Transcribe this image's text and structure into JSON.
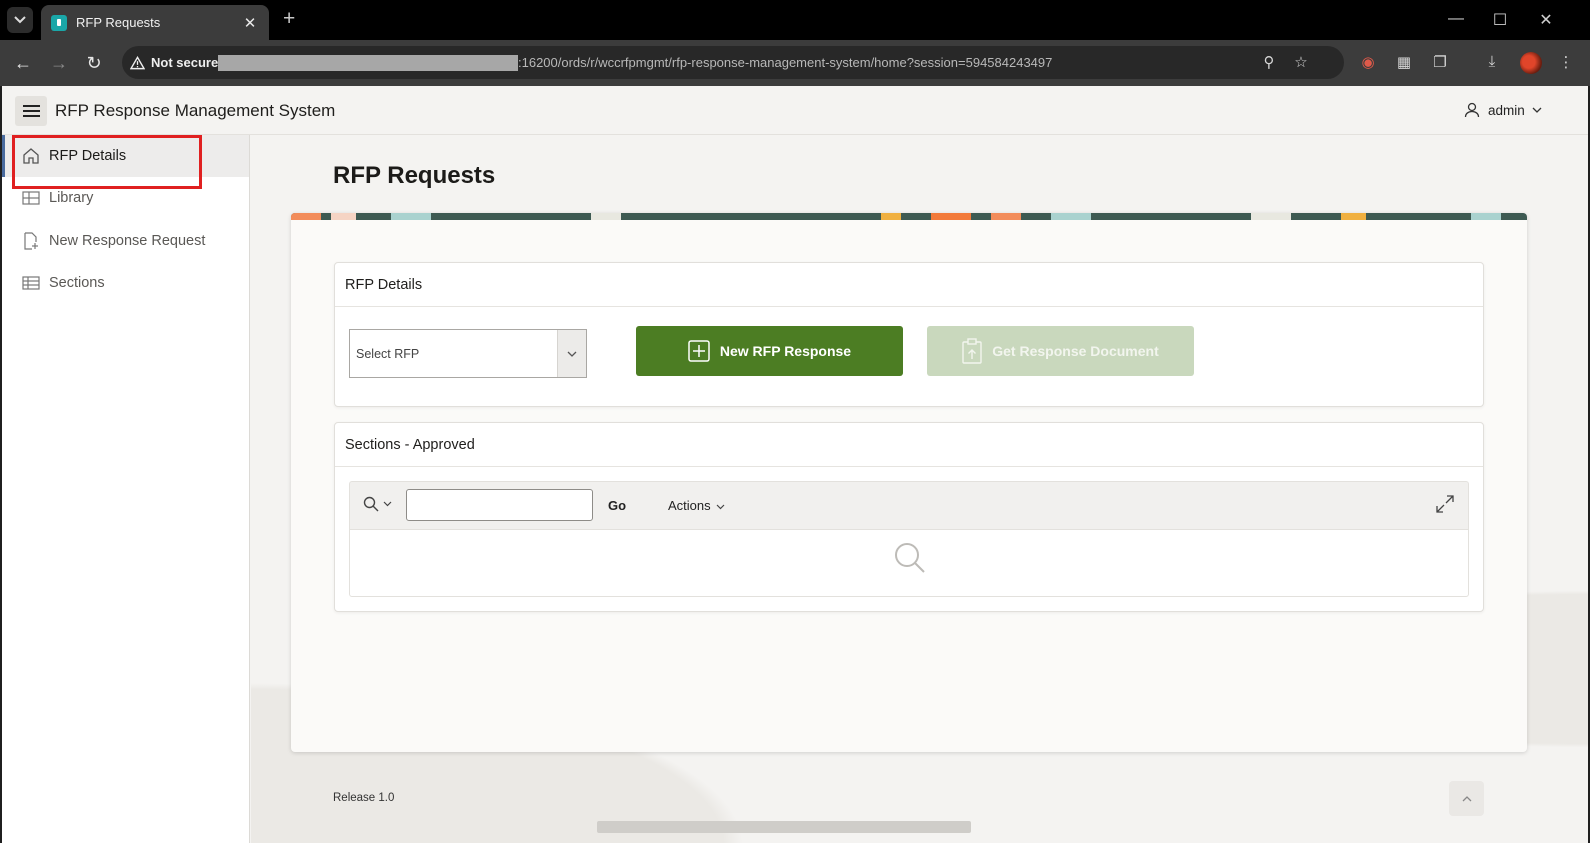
{
  "browser": {
    "tab_title": "RFP Requests",
    "tab_close": "✕",
    "new_tab": "+",
    "security_label": "Not secure",
    "url": ":16200/ords/r/wccrfpmgmt/rfp-response-management-system/home?session=594584243497"
  },
  "app": {
    "title": "RFP Response Management System",
    "user": "admin"
  },
  "sidebar": {
    "items": [
      {
        "label": "RFP Details",
        "icon": "home-icon",
        "active": true
      },
      {
        "label": "Library",
        "icon": "grid-icon",
        "active": false
      },
      {
        "label": "New Response Request",
        "icon": "new-document-icon",
        "active": false
      },
      {
        "label": "Sections",
        "icon": "table-icon",
        "active": false
      }
    ]
  },
  "page": {
    "title": "RFP Requests",
    "rfp_details": {
      "title": "RFP Details",
      "select_placeholder": "Select RFP",
      "new_button": "New RFP Response",
      "get_button": "Get Response Document"
    },
    "sections": {
      "title": "Sections - Approved",
      "go": "Go",
      "actions": "Actions"
    },
    "footer": "Release 1.0"
  },
  "colors": {
    "primary_button": "#4c7d23",
    "disabled_button": "#c9d8bd",
    "highlight": "#e02020"
  }
}
